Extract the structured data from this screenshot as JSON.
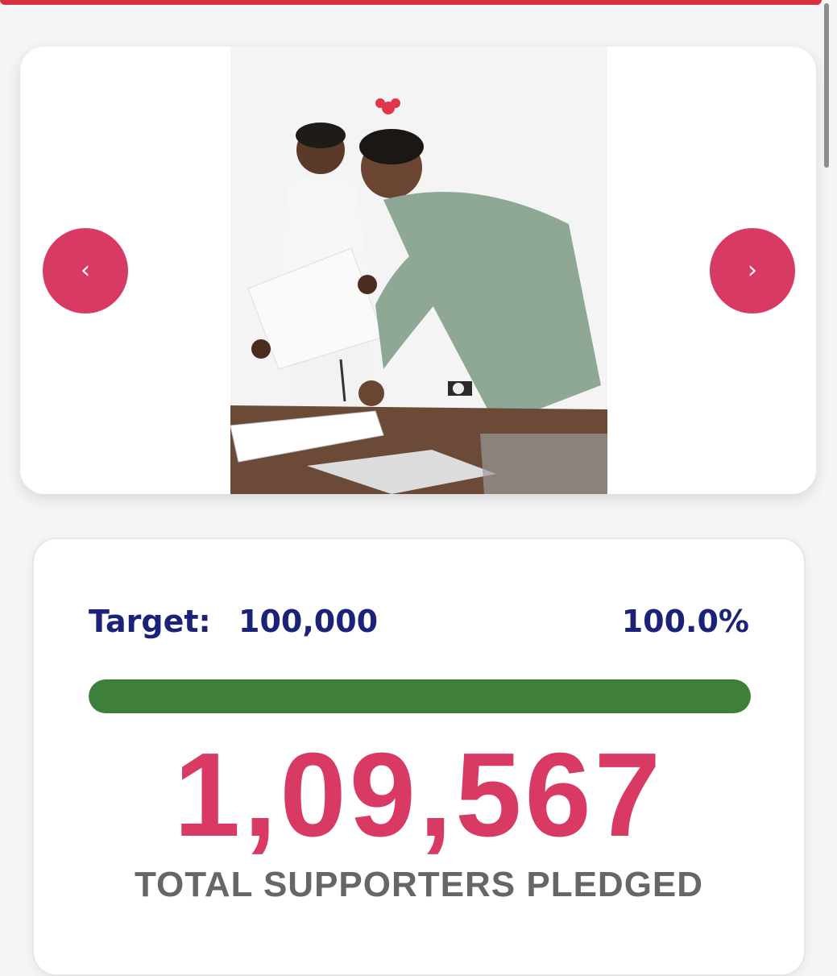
{
  "carousel": {
    "prev_label": "‹",
    "next_label": "›",
    "photo_description_icon": "photo"
  },
  "pledge_stats": {
    "target_label": "Target:",
    "target_value": "100,000",
    "percent": "100.0%",
    "progress_fraction": 1.0,
    "total_count": "1,09,567",
    "total_label": "TOTAL SUPPORTERS PLEDGED"
  },
  "colors": {
    "accent": "#d93a64",
    "progress": "#3e7f3a",
    "target_text": "#1c2278",
    "top_bar": "#d9303e"
  }
}
